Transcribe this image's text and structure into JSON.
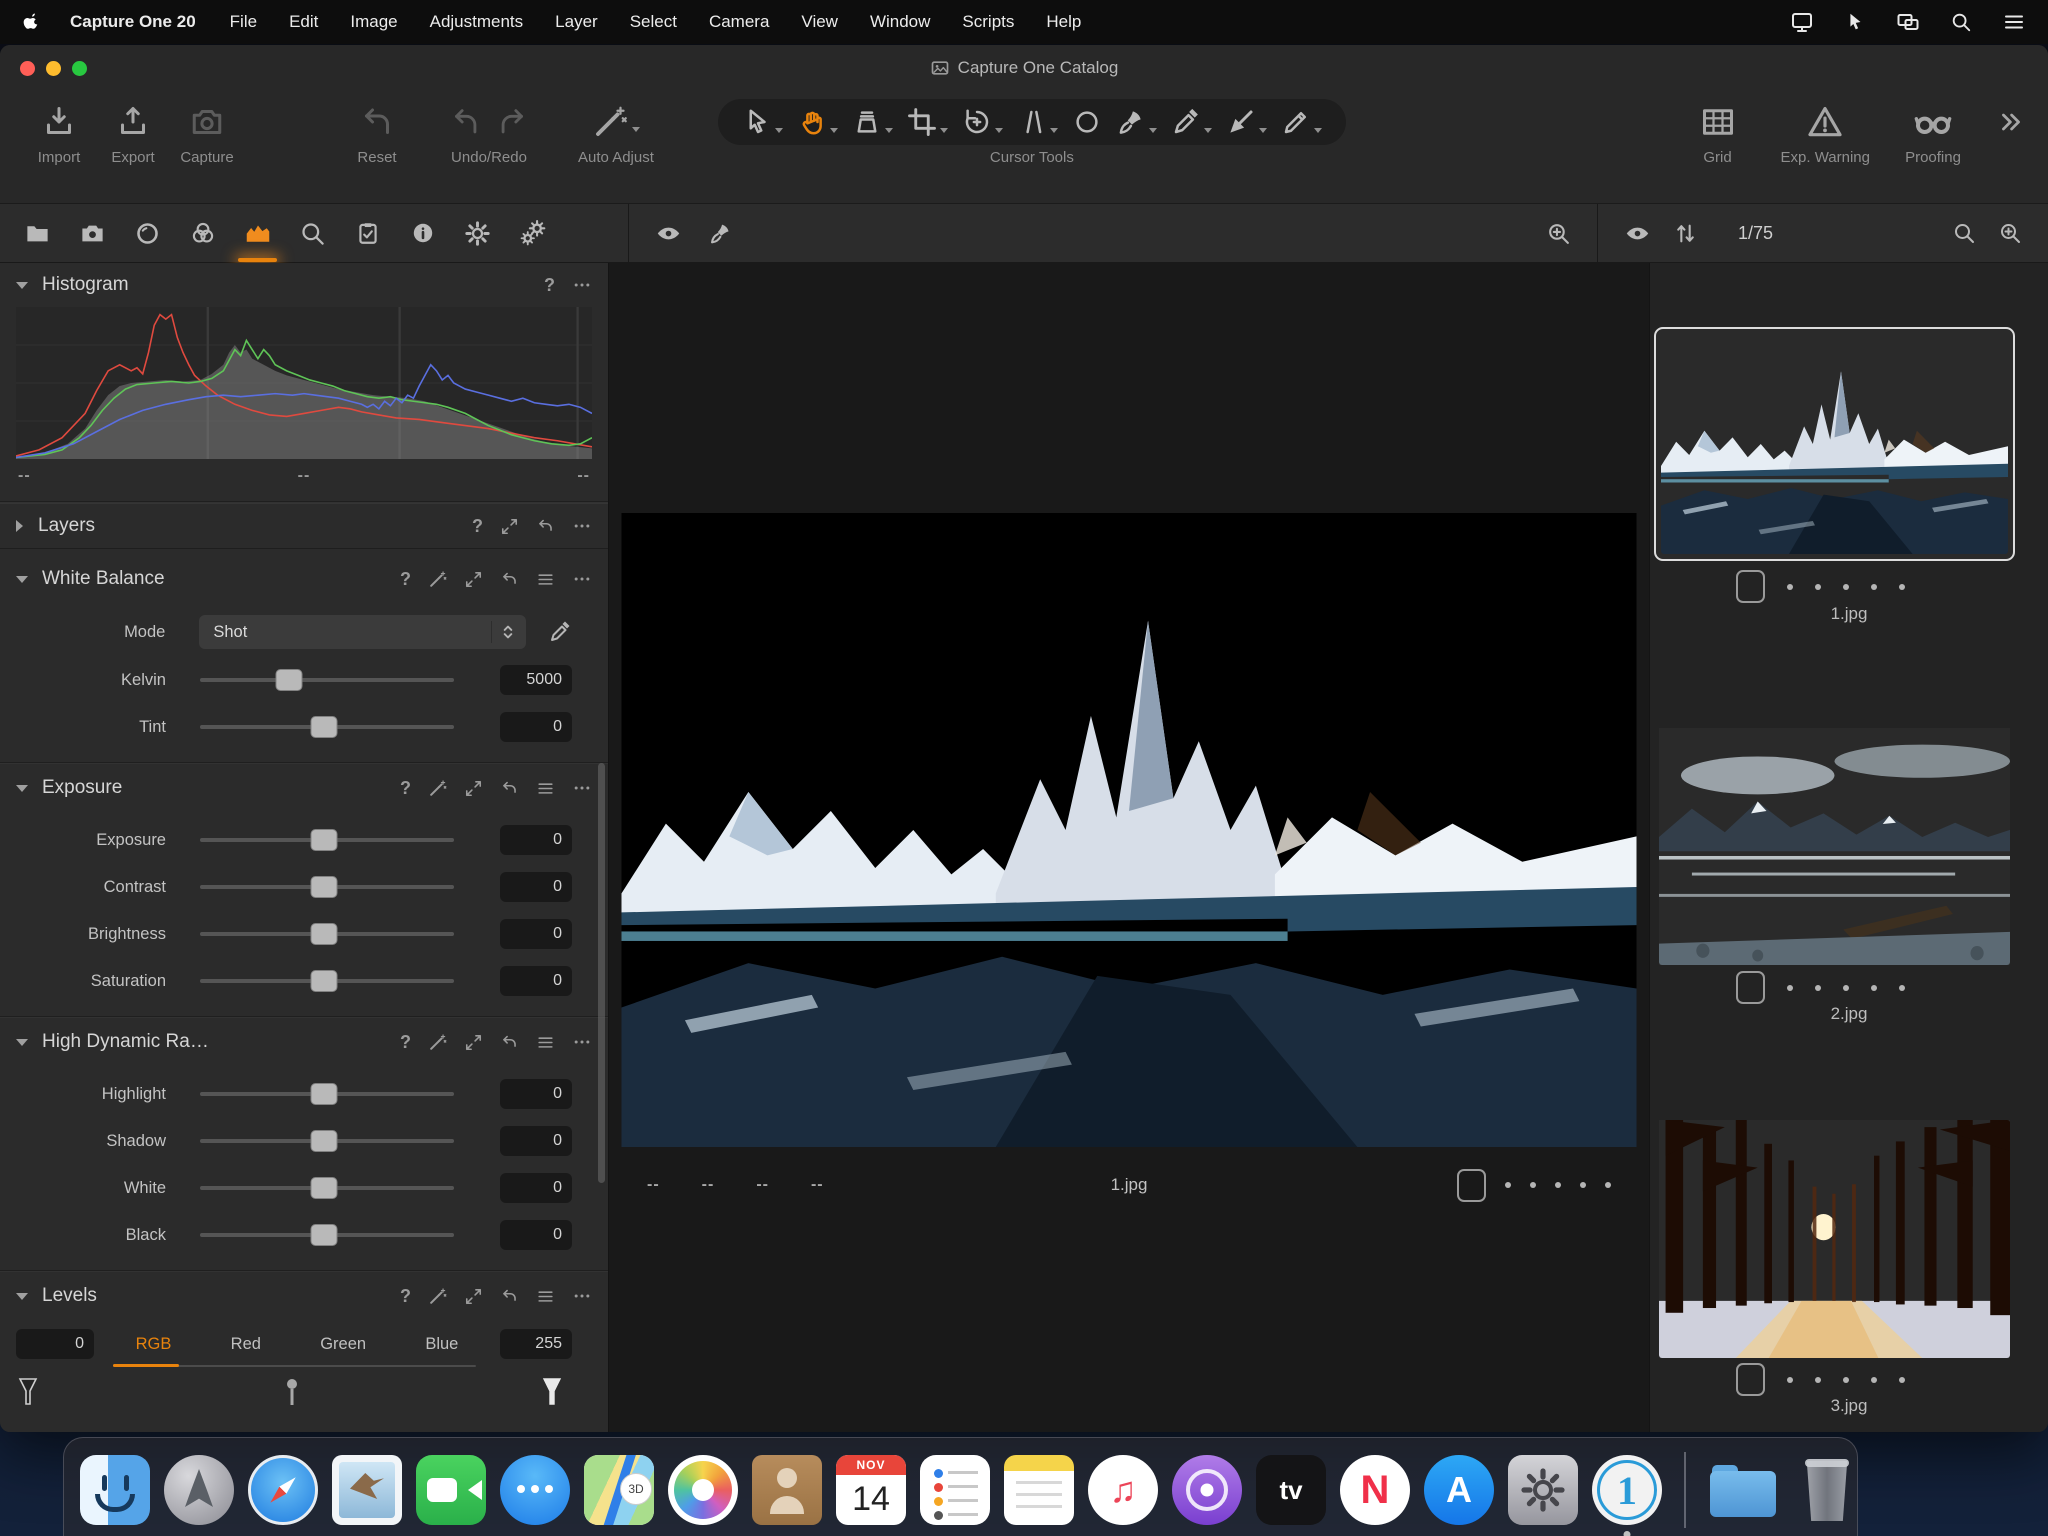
{
  "menu_bar": {
    "app_name": "Capture One 20",
    "items": [
      "File",
      "Edit",
      "Image",
      "Adjustments",
      "Layer",
      "Select",
      "Camera",
      "View",
      "Window",
      "Scripts",
      "Help"
    ]
  },
  "window_title": "Capture One Catalog",
  "toolbar": {
    "import": "Import",
    "export": "Export",
    "capture": "Capture",
    "reset": "Reset",
    "undo_redo": "Undo/Redo",
    "auto_adjust": "Auto Adjust",
    "cursor_tools_label": "Cursor Tools",
    "grid": "Grid",
    "exp_warning": "Exp. Warning",
    "proofing": "Proofing"
  },
  "viewer": {
    "filename": "1.jpg",
    "meta": [
      "--",
      "--",
      "--",
      "--"
    ]
  },
  "browser": {
    "counter": "1/75",
    "thumbs": [
      {
        "name": "1.jpg",
        "selected": true
      },
      {
        "name": "2.jpg",
        "selected": false
      },
      {
        "name": "3.jpg",
        "selected": false
      }
    ]
  },
  "panels": {
    "histogram": {
      "title": "Histogram",
      "footer": [
        "--",
        "--",
        "--"
      ],
      "colors": {
        "red": "#e04a3f",
        "green": "#5fc457",
        "blue": "#5a6fe0",
        "luma": "#909090"
      },
      "series": {
        "red": [
          [
            0,
            2
          ],
          [
            4,
            6
          ],
          [
            8,
            14
          ],
          [
            12,
            30
          ],
          [
            14,
            45
          ],
          [
            16,
            58
          ],
          [
            18,
            62
          ],
          [
            20,
            58
          ],
          [
            21,
            60
          ],
          [
            22,
            56
          ],
          [
            23,
            70
          ],
          [
            24,
            88
          ],
          [
            25,
            95
          ],
          [
            26,
            92
          ],
          [
            27,
            95
          ],
          [
            28,
            80
          ],
          [
            29,
            70
          ],
          [
            30,
            62
          ],
          [
            31,
            55
          ],
          [
            33,
            48
          ],
          [
            35,
            42
          ],
          [
            38,
            36
          ],
          [
            41,
            32
          ],
          [
            44,
            29
          ],
          [
            47,
            28
          ],
          [
            50,
            30
          ],
          [
            53,
            32
          ],
          [
            56,
            34
          ],
          [
            58,
            33
          ],
          [
            60,
            31
          ],
          [
            63,
            29
          ],
          [
            66,
            27
          ],
          [
            70,
            26
          ],
          [
            74,
            24
          ],
          [
            78,
            22
          ],
          [
            82,
            20
          ],
          [
            86,
            17
          ],
          [
            90,
            14
          ],
          [
            94,
            12
          ],
          [
            97,
            10
          ],
          [
            100,
            8
          ]
        ],
        "green": [
          [
            0,
            1
          ],
          [
            5,
            3
          ],
          [
            8,
            6
          ],
          [
            11,
            14
          ],
          [
            13,
            22
          ],
          [
            15,
            32
          ],
          [
            17,
            40
          ],
          [
            19,
            46
          ],
          [
            21,
            49
          ],
          [
            24,
            50
          ],
          [
            27,
            51
          ],
          [
            30,
            50
          ],
          [
            32,
            51
          ],
          [
            34,
            53
          ],
          [
            36,
            58
          ],
          [
            37,
            65
          ],
          [
            38,
            72
          ],
          [
            39,
            68
          ],
          [
            40,
            78
          ],
          [
            41,
            72
          ],
          [
            42,
            66
          ],
          [
            43,
            72
          ],
          [
            44,
            68
          ],
          [
            45,
            62
          ],
          [
            47,
            58
          ],
          [
            49,
            55
          ],
          [
            51,
            52
          ],
          [
            53,
            50
          ],
          [
            55,
            48
          ],
          [
            57,
            45
          ],
          [
            59,
            43
          ],
          [
            61,
            41
          ],
          [
            63,
            40
          ],
          [
            65,
            41
          ],
          [
            67,
            39
          ],
          [
            69,
            38
          ],
          [
            71,
            37
          ],
          [
            73,
            36
          ],
          [
            75,
            34
          ],
          [
            78,
            30
          ],
          [
            80,
            26
          ],
          [
            82,
            22
          ],
          [
            84,
            19
          ],
          [
            86,
            16
          ],
          [
            88,
            14
          ],
          [
            90,
            12
          ],
          [
            93,
            10
          ],
          [
            96,
            9
          ],
          [
            98,
            10
          ],
          [
            100,
            14
          ]
        ],
        "blue": [
          [
            0,
            1
          ],
          [
            5,
            4
          ],
          [
            10,
            10
          ],
          [
            14,
            18
          ],
          [
            18,
            26
          ],
          [
            22,
            32
          ],
          [
            26,
            36
          ],
          [
            30,
            39
          ],
          [
            33,
            41
          ],
          [
            36,
            42
          ],
          [
            39,
            41
          ],
          [
            42,
            42
          ],
          [
            45,
            43
          ],
          [
            48,
            42
          ],
          [
            50,
            43
          ],
          [
            52,
            42
          ],
          [
            54,
            41
          ],
          [
            56,
            40
          ],
          [
            58,
            38
          ],
          [
            60,
            36
          ],
          [
            61,
            34
          ],
          [
            62,
            36
          ],
          [
            63,
            33
          ],
          [
            64,
            38
          ],
          [
            65,
            35
          ],
          [
            66,
            40
          ],
          [
            67,
            37
          ],
          [
            68,
            42
          ],
          [
            69,
            40
          ],
          [
            70,
            48
          ],
          [
            71,
            55
          ],
          [
            72,
            62
          ],
          [
            73,
            58
          ],
          [
            74,
            52
          ],
          [
            75,
            55
          ],
          [
            76,
            50
          ],
          [
            77,
            48
          ],
          [
            78,
            46
          ],
          [
            80,
            44
          ],
          [
            82,
            42
          ],
          [
            84,
            40
          ],
          [
            86,
            38
          ],
          [
            88,
            40
          ],
          [
            90,
            37
          ],
          [
            92,
            36
          ],
          [
            94,
            35
          ],
          [
            96,
            36
          ],
          [
            98,
            34
          ],
          [
            100,
            30
          ]
        ],
        "luma": [
          [
            0,
            1
          ],
          [
            5,
            4
          ],
          [
            9,
            10
          ],
          [
            12,
            20
          ],
          [
            14,
            32
          ],
          [
            16,
            42
          ],
          [
            18,
            48
          ],
          [
            20,
            50
          ],
          [
            23,
            51
          ],
          [
            26,
            52
          ],
          [
            29,
            51
          ],
          [
            32,
            52
          ],
          [
            34,
            56
          ],
          [
            36,
            62
          ],
          [
            37,
            70
          ],
          [
            38,
            75
          ],
          [
            39,
            70
          ],
          [
            40,
            72
          ],
          [
            41,
            66
          ],
          [
            43,
            62
          ],
          [
            45,
            58
          ],
          [
            47,
            55
          ],
          [
            50,
            52
          ],
          [
            53,
            49
          ],
          [
            56,
            46
          ],
          [
            59,
            44
          ],
          [
            62,
            42
          ],
          [
            65,
            41
          ],
          [
            68,
            40
          ],
          [
            71,
            38
          ],
          [
            74,
            34
          ],
          [
            77,
            30
          ],
          [
            80,
            26
          ],
          [
            83,
            22
          ],
          [
            86,
            18
          ],
          [
            89,
            14
          ],
          [
            92,
            11
          ],
          [
            95,
            9
          ],
          [
            100,
            7
          ]
        ]
      }
    },
    "layers": {
      "title": "Layers"
    },
    "white_balance": {
      "title": "White Balance",
      "mode_label": "Mode",
      "mode_value": "Shot",
      "rows": [
        {
          "label": "Kelvin",
          "value": "5000",
          "pos": 35
        },
        {
          "label": "Tint",
          "value": "0",
          "pos": 49
        }
      ]
    },
    "exposure": {
      "title": "Exposure",
      "rows": [
        {
          "label": "Exposure",
          "value": "0",
          "pos": 49
        },
        {
          "label": "Contrast",
          "value": "0",
          "pos": 49
        },
        {
          "label": "Brightness",
          "value": "0",
          "pos": 49
        },
        {
          "label": "Saturation",
          "value": "0",
          "pos": 49
        }
      ]
    },
    "hdr": {
      "title": "High Dynamic Ra…",
      "rows": [
        {
          "label": "Highlight",
          "value": "0",
          "pos": 49
        },
        {
          "label": "Shadow",
          "value": "0",
          "pos": 49
        },
        {
          "label": "White",
          "value": "0",
          "pos": 49
        },
        {
          "label": "Black",
          "value": "0",
          "pos": 49
        }
      ]
    },
    "levels": {
      "title": "Levels",
      "low": "0",
      "high": "255",
      "channels": [
        "RGB",
        "Red",
        "Green",
        "Blue"
      ],
      "active": "RGB"
    }
  },
  "dock": {
    "items": [
      "finder",
      "launchpad",
      "safari",
      "mail",
      "facetime",
      "messages",
      "maps",
      "photos",
      "contacts",
      "calendar",
      "reminders",
      "notes",
      "music",
      "podcasts",
      "apple-tv",
      "news",
      "app-store",
      "system-preferences",
      "capture-one",
      "folder",
      "trash"
    ],
    "calendar_month": "NOV",
    "calendar_day": "14",
    "maps_badge": "3D",
    "tv_label": "tv",
    "news_label": "N",
    "appstore_label": "A",
    "captureone_label": "1",
    "music_note": "♫"
  },
  "accent": {
    "orange": "#e8830d"
  }
}
